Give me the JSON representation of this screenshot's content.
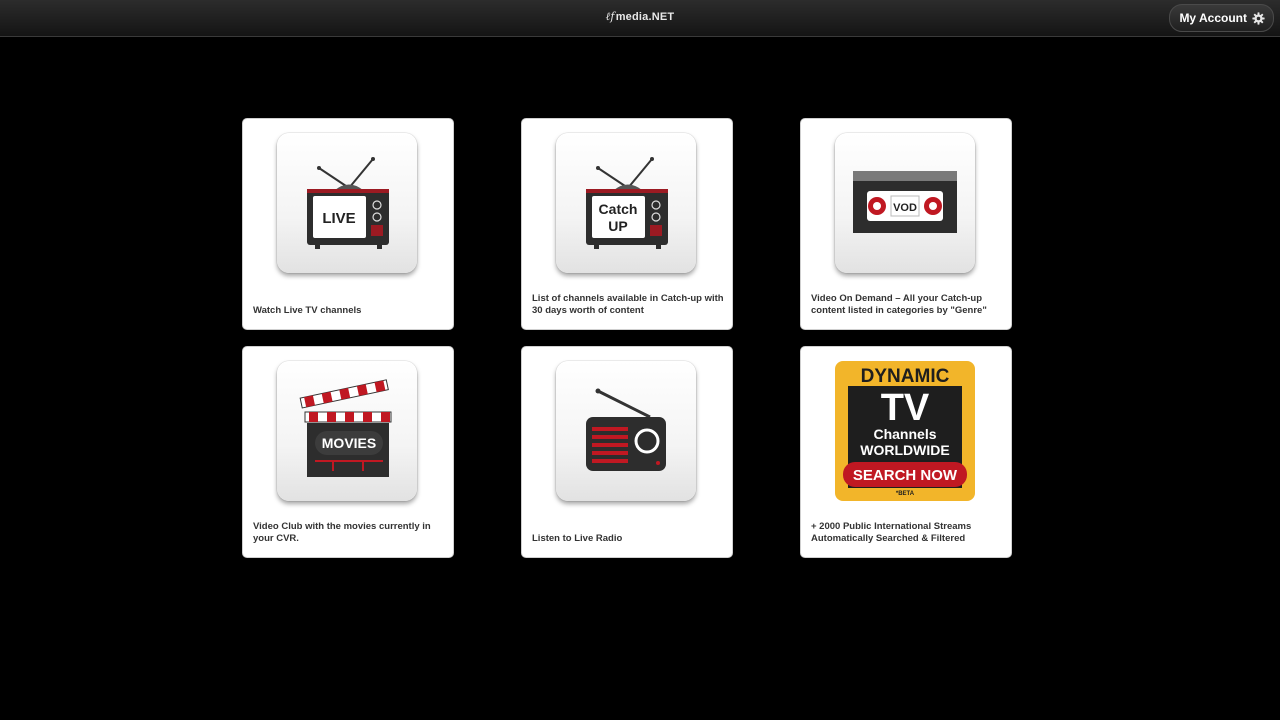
{
  "header": {
    "logo_mark": "ℓf",
    "logo_text": "media.NET",
    "account_label": "My Account"
  },
  "cards": [
    {
      "icon": "live-tv-icon",
      "icon_label": "LIVE",
      "description": "Watch Live TV channels"
    },
    {
      "icon": "catch-up-tv-icon",
      "icon_label_1": "Catch",
      "icon_label_2": "UP",
      "description": "List of channels available in Catch-up with 30 days worth of content"
    },
    {
      "icon": "vod-cassette-icon",
      "icon_label": "VOD",
      "description": "Video On Demand – All your Catch-up content listed in categories by \"Genre\""
    },
    {
      "icon": "movies-clapperboard-icon",
      "icon_label": "MOVIES",
      "description": "Video Club with the movies currently in your CVR."
    },
    {
      "icon": "radio-icon",
      "description": "Listen to Live Radio"
    },
    {
      "icon": "dynamic-tv-icon",
      "line_1": "DYNAMIC",
      "line_2": "TV",
      "line_3": "Channels",
      "line_4": "WORLDWIDE",
      "button": "SEARCH NOW",
      "badge": "*BETA",
      "description": "+ 2000 Public International Streams Automatically Searched & Filtered"
    }
  ],
  "colors": {
    "accent_red": "#b01a24",
    "bg": "#000000",
    "card_bg": "#ffffff",
    "tv_body": "#2d2d2d",
    "dynamic_yellow": "#f2b52a"
  }
}
